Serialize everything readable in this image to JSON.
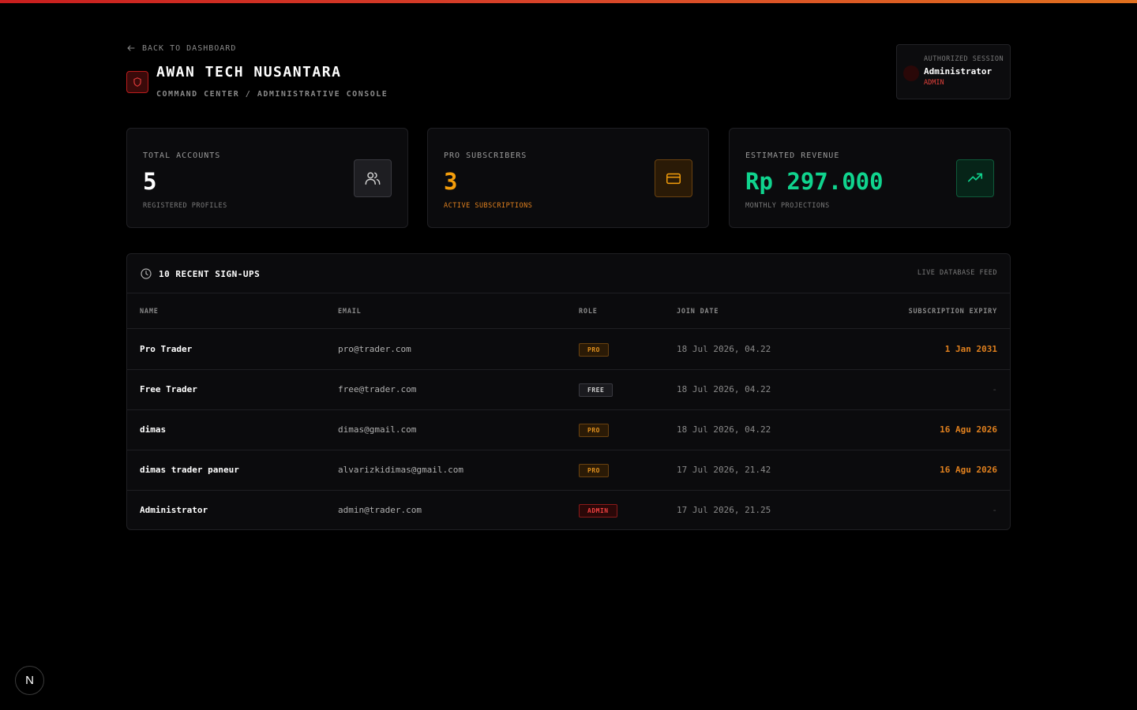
{
  "header": {
    "back_label": "Back to Dashboard",
    "title": "AWAN TECH NUSANTARA",
    "subtitle": "Command Center / Administrative Console"
  },
  "session": {
    "label": "Authorized Session",
    "name": "Administrator",
    "role": "ADMIN"
  },
  "stats": [
    {
      "label": "Total Accounts",
      "value": "5",
      "foot": "Registered Profiles",
      "icon": "users-icon",
      "accent": "#ffffff"
    },
    {
      "label": "Pro Subscribers",
      "value": "3",
      "foot": "Active Subscriptions",
      "icon": "credit-card-icon",
      "accent": "#f59e0b"
    },
    {
      "label": "Estimated Revenue",
      "value": "Rp 297.000",
      "foot": "Monthly Projections",
      "icon": "trending-up-icon",
      "accent": "#10d48e"
    }
  ],
  "table": {
    "title": "10 Recent Sign-Ups",
    "feed_label": "Live Database Feed",
    "columns": [
      "Name",
      "Email",
      "Role",
      "Join Date",
      "Subscription Expiry"
    ],
    "rows": [
      {
        "name": "Pro Trader",
        "email": "pro@trader.com",
        "role": "PRO",
        "join": "18 Jul 2026, 04.22",
        "expiry": "1 Jan 2031"
      },
      {
        "name": "Free Trader",
        "email": "free@trader.com",
        "role": "FREE",
        "join": "18 Jul 2026, 04.22",
        "expiry": "-"
      },
      {
        "name": "dimas",
        "email": "dimas@gmail.com",
        "role": "PRO",
        "join": "18 Jul 2026, 04.22",
        "expiry": "16 Agu 2026"
      },
      {
        "name": "dimas trader paneur",
        "email": "alvarizkidimas@gmail.com",
        "role": "PRO",
        "join": "17 Jul 2026, 21.42",
        "expiry": "16 Agu 2026"
      },
      {
        "name": "Administrator",
        "email": "admin@trader.com",
        "role": "ADMIN",
        "join": "17 Jul 2026, 21.25",
        "expiry": "-"
      }
    ]
  },
  "next_badge": "N"
}
